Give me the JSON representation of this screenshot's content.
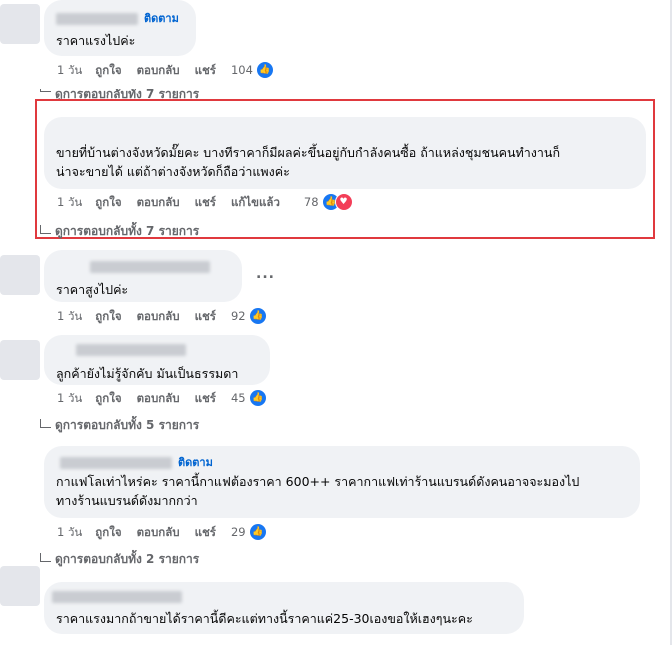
{
  "follow_label": "ติดตาม",
  "comments": [
    {
      "text": "ราคาแรงไปค่ะ",
      "time": "1 วัน",
      "like": "ถูกใจ",
      "reply": "ตอบกลับ",
      "share": "แชร์",
      "reactions": "104",
      "replies": "ดูการตอบกลับทั้ง 7 รายการ"
    },
    {
      "text_line1": "ขายที่บ้านต่างจังหวัดมั๊ยคะ บางทีราคาก็มีผลค่ะขึ้นอยู่กับกำลังคนซื้อ ถ้าแหล่งชุมชนคนทำงานก็",
      "text_line2": "น่าจะขายได้ แต่ถ้าต่างจังหวัดก็ถือว่าแพงค่ะ",
      "time": "1 วัน",
      "like": "ถูกใจ",
      "reply": "ตอบกลับ",
      "share": "แชร์",
      "edited": "แก้ไขแล้ว",
      "reactions": "78",
      "replies": "ดูการตอบกลับทั้ง 7 รายการ"
    },
    {
      "text": "ราคาสูงไปค่ะ",
      "time": "1 วัน",
      "like": "ถูกใจ",
      "reply": "ตอบกลับ",
      "share": "แชร์",
      "reactions": "92",
      "more": "..."
    },
    {
      "text": "ลูกค้ายังไม่รู้จักคับ มันเป็นธรรมดา",
      "time": "1 วัน",
      "like": "ถูกใจ",
      "reply": "ตอบกลับ",
      "share": "แชร์",
      "reactions": "45",
      "replies": "ดูการตอบกลับทั้ง 5 รายการ"
    },
    {
      "text_line1": "กาแฟโลเท่าไหร่คะ ราคานี้กาแฟต้องราคา 600++ ราคากาแฟเท่าร้านแบรนด์ดังคนอาจจะมองไป",
      "text_line2": "ทางร้านแบรนด์ดังมากกว่า",
      "time": "1 วัน",
      "like": "ถูกใจ",
      "reply": "ตอบกลับ",
      "share": "แชร์",
      "reactions": "29",
      "replies": "ดูการตอบกลับทั้ง 2 รายการ"
    },
    {
      "text": "ราคาแรงมากถ้าขายได้ราคานี้ดีคะแต่ทางนี้ราคาแค่25-30เองขอให้เฮงๆนะคะ"
    }
  ],
  "colors": {
    "bubble": "#f0f2f5",
    "accent": "#0064d1",
    "like": "#1877f2",
    "love": "#f33e58",
    "highlight": "#e0393e"
  }
}
